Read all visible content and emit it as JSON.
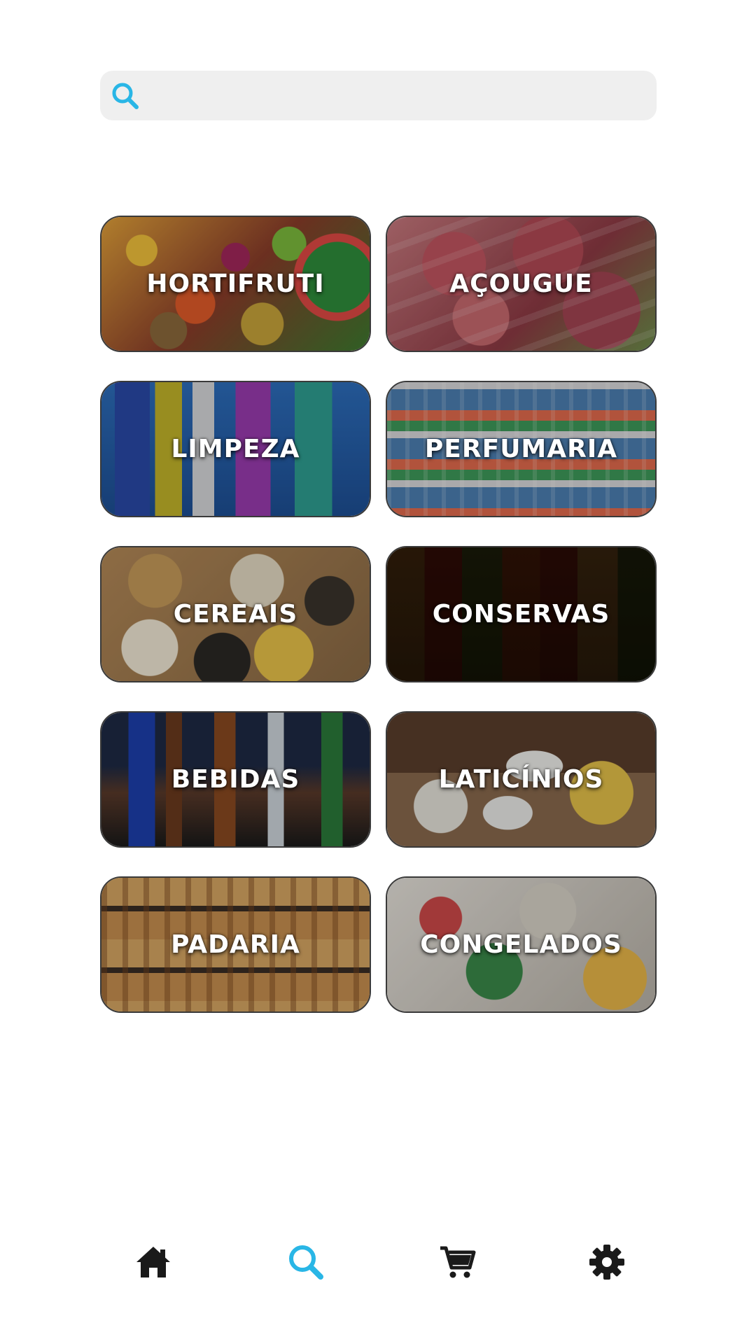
{
  "search": {
    "value": "",
    "placeholder": "",
    "icon": "search-icon",
    "accent": "#29b6e6"
  },
  "categories": [
    {
      "label": "HORTIFRUTI"
    },
    {
      "label": "AÇOUGUE"
    },
    {
      "label": "LIMPEZA"
    },
    {
      "label": "PERFUMARIA"
    },
    {
      "label": "CEREAIS"
    },
    {
      "label": "CONSERVAS"
    },
    {
      "label": "BEBIDAS"
    },
    {
      "label": "LATICÍNIOS"
    },
    {
      "label": "PADARIA"
    },
    {
      "label": "CONGELADOS"
    }
  ],
  "bottom_nav": {
    "items": [
      {
        "icon": "home-icon",
        "active": false
      },
      {
        "icon": "search-icon",
        "active": true
      },
      {
        "icon": "cart-icon",
        "active": false
      },
      {
        "icon": "gear-icon",
        "active": false
      }
    ],
    "active_color": "#29b6e6",
    "inactive_color": "#1a1a1a"
  }
}
